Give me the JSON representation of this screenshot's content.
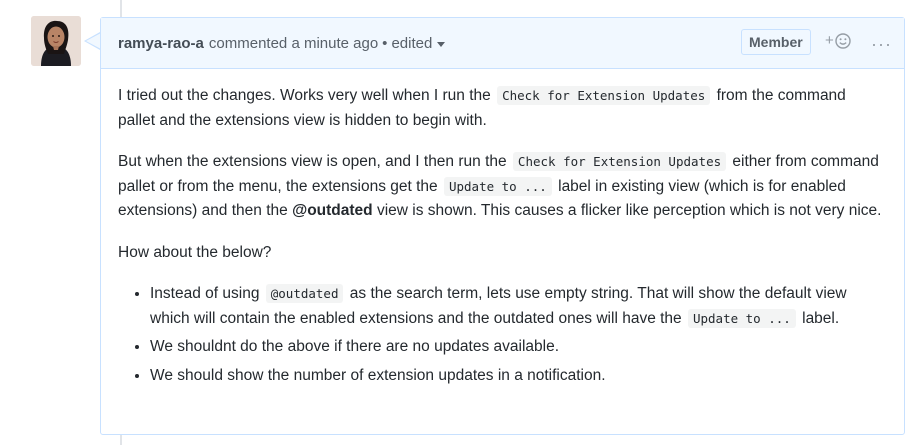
{
  "comment": {
    "author": "ramya-rao-a",
    "action": "commented",
    "time": "a minute ago",
    "bullet": "•",
    "edited": "edited",
    "badge": "Member",
    "reaction_plus": "+",
    "more": "···",
    "avatar_icon": "avatar-photo",
    "colors": {
      "header_bg": "#f1f8ff",
      "border": "#c8e1ff",
      "text": "#24292e",
      "muted": "#586069",
      "code_bg": "#f3f4f4"
    }
  },
  "body": {
    "p1": {
      "t1": "I tried out the changes. Works very well when I run the ",
      "code1": "Check for Extension Updates",
      "t2": " from the command pallet and the extensions view is hidden to begin with."
    },
    "p2": {
      "t1": "But when the extensions view is open, and I then run the ",
      "code1": "Check for Extension Updates",
      "t2": " either from command pallet or from the menu, the extensions get the ",
      "code2": "Update to ...",
      "t3": " label in existing view (which is for enabled extensions) and then the ",
      "bold1": "@outdated",
      "t4": " view is shown. This causes a flicker like perception which is not very nice."
    },
    "p3": "How about the below?",
    "list": {
      "li1": {
        "t1": "Instead of using ",
        "code1": "@outdated",
        "t2": " as the search term, lets use empty string. That will show the default view which will contain the enabled extensions and the outdated ones will have the ",
        "code2": "Update to ...",
        "t3": " label."
      },
      "li2": "We shouldnt do the above if there are no updates available.",
      "li3": "We should show the number of extension updates in a notification."
    }
  }
}
